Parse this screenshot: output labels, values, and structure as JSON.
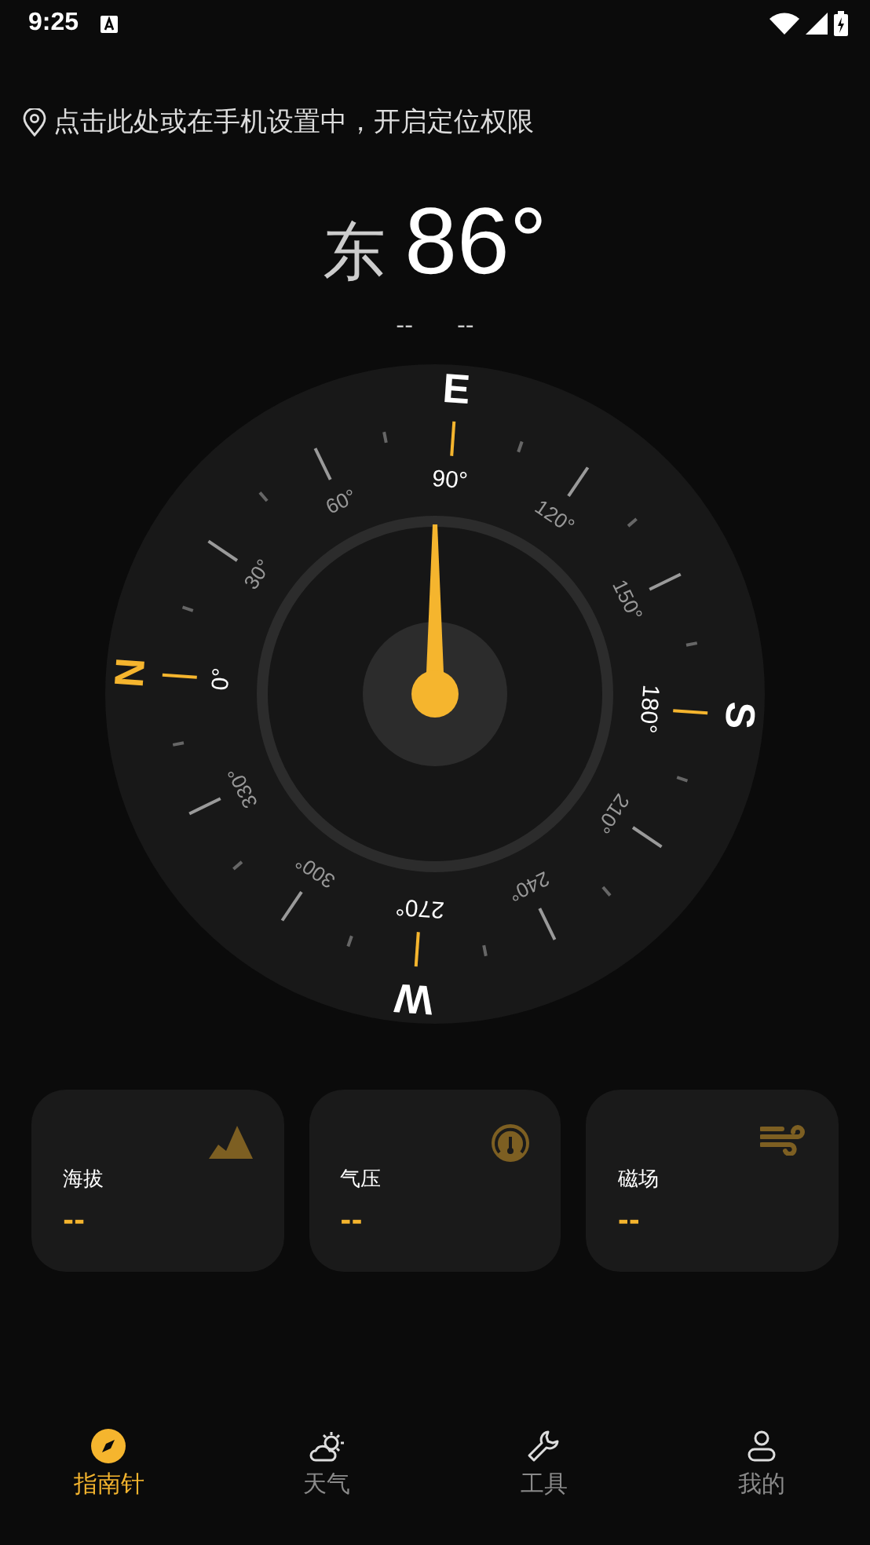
{
  "status_bar": {
    "time": "9:25"
  },
  "location_prompt": "点击此处或在手机设置中，开启定位权限",
  "heading": {
    "direction": "东",
    "degrees": "86°",
    "coordinates": [
      "--",
      "--"
    ]
  },
  "compass": {
    "cardinals": [
      {
        "label": "N",
        "color": "#f5b52e"
      },
      {
        "label": "E",
        "color": "#ffffff"
      },
      {
        "label": "S",
        "color": "#ffffff"
      },
      {
        "label": "W",
        "color": "#ffffff"
      }
    ],
    "degree_labels": [
      "0°",
      "30°",
      "60°",
      "90°",
      "120°",
      "150°",
      "180°",
      "210°",
      "240°",
      "270°",
      "300°",
      "330°"
    ]
  },
  "cards": [
    {
      "kind": "altitude",
      "label": "海拔",
      "value": "--"
    },
    {
      "kind": "pressure",
      "label": "气压",
      "value": "--"
    },
    {
      "kind": "magnetic",
      "label": "磁场",
      "value": "--"
    }
  ],
  "tabs": [
    {
      "kind": "compass",
      "label": "指南针",
      "selected": true
    },
    {
      "kind": "weather",
      "label": "天气",
      "selected": false
    },
    {
      "kind": "tools",
      "label": "工具",
      "selected": false
    },
    {
      "kind": "profile",
      "label": "我的",
      "selected": false
    }
  ]
}
